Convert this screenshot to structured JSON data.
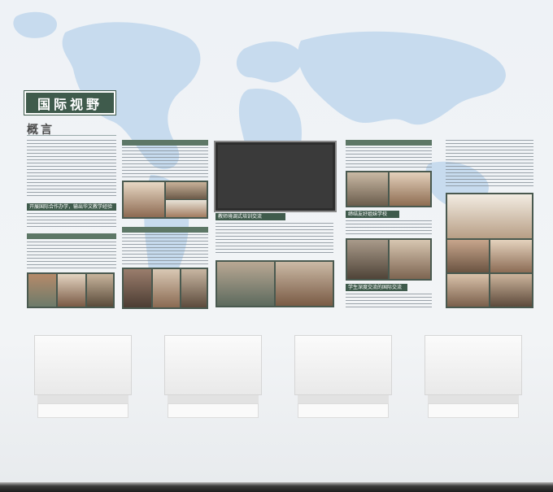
{
  "title": "国际视野",
  "subtitle": "概言",
  "sections": {
    "col1_heading": "开展国际合作办学，输出华文教学经验",
    "col2_heading": "",
    "col3_heading": "教师境调式培训交流",
    "col4_heading_a": "缔结友好姐妹学校",
    "col4_heading_b": "学生深度交流的国际交流"
  },
  "colors": {
    "panel": "#3f5b4c",
    "map": "#cfe0f0",
    "wall": "#eef2f6"
  }
}
